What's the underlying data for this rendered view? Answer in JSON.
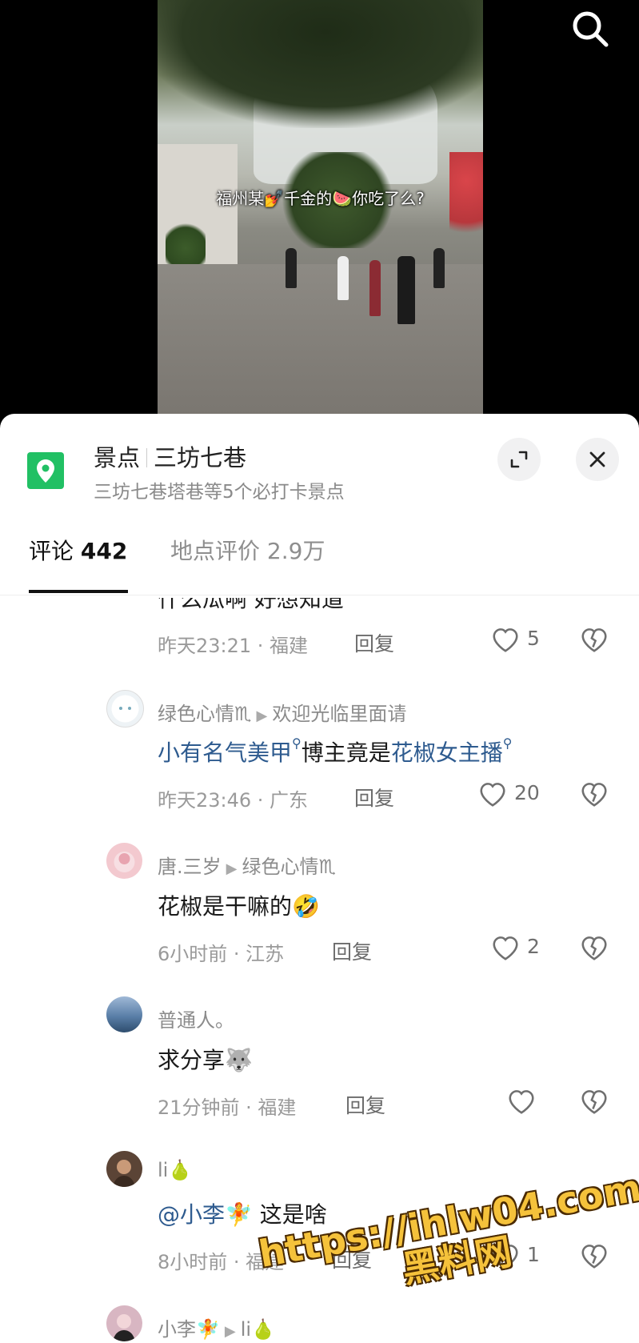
{
  "video": {
    "caption": "福州某💅千金的🍉你吃了么?"
  },
  "location": {
    "category": "景点",
    "name": "三坊七巷",
    "subtitle": "三坊七巷塔巷等5个必打卡景点"
  },
  "tabs": {
    "comments_label": "评论",
    "comments_count": "442",
    "ratings_label": "地点评价",
    "ratings_value": "2.9万"
  },
  "comments": [
    {
      "partial_text": "什么瓜啊 好想知道",
      "time": "昨天23:21 · 福建",
      "reply": "回复",
      "likes": "5"
    },
    {
      "name": "绿色心情♏",
      "reply_to": "欢迎光临里面请",
      "text_mention_1": "小有名气美甲",
      "text_mid": "博主竟是",
      "text_mention_2": "花椒女主播",
      "time": "昨天23:46 · 广东",
      "reply": "回复",
      "likes": "20"
    },
    {
      "name": "唐.三岁",
      "reply_to": "绿色心情♏",
      "text": "花椒是干嘛的🤣",
      "time": "6小时前 · 江苏",
      "reply": "回复",
      "likes": "2"
    },
    {
      "name": "普通人。",
      "text": "求分享🐺",
      "time": "21分钟前 · 福建",
      "reply": "回复",
      "likes": ""
    },
    {
      "name": "li🍐",
      "text_mention": "@小李🧚",
      "text": "这是啥",
      "time": "8小时前 · 福建",
      "reply": "回复",
      "likes": "1"
    },
    {
      "name": "小李🧚",
      "reply_to": "li🍐"
    }
  ],
  "watermark": {
    "url": "https://ihlw04.com",
    "label": "黑料网"
  },
  "colors": {
    "location_icon": "#21c064",
    "mention": "#2e5b8f",
    "watermark": "#f5c23b"
  },
  "icons": [
    "search-icon",
    "location-pin-icon",
    "expand-icon",
    "close-icon",
    "heart-icon",
    "broken-heart-icon"
  ]
}
